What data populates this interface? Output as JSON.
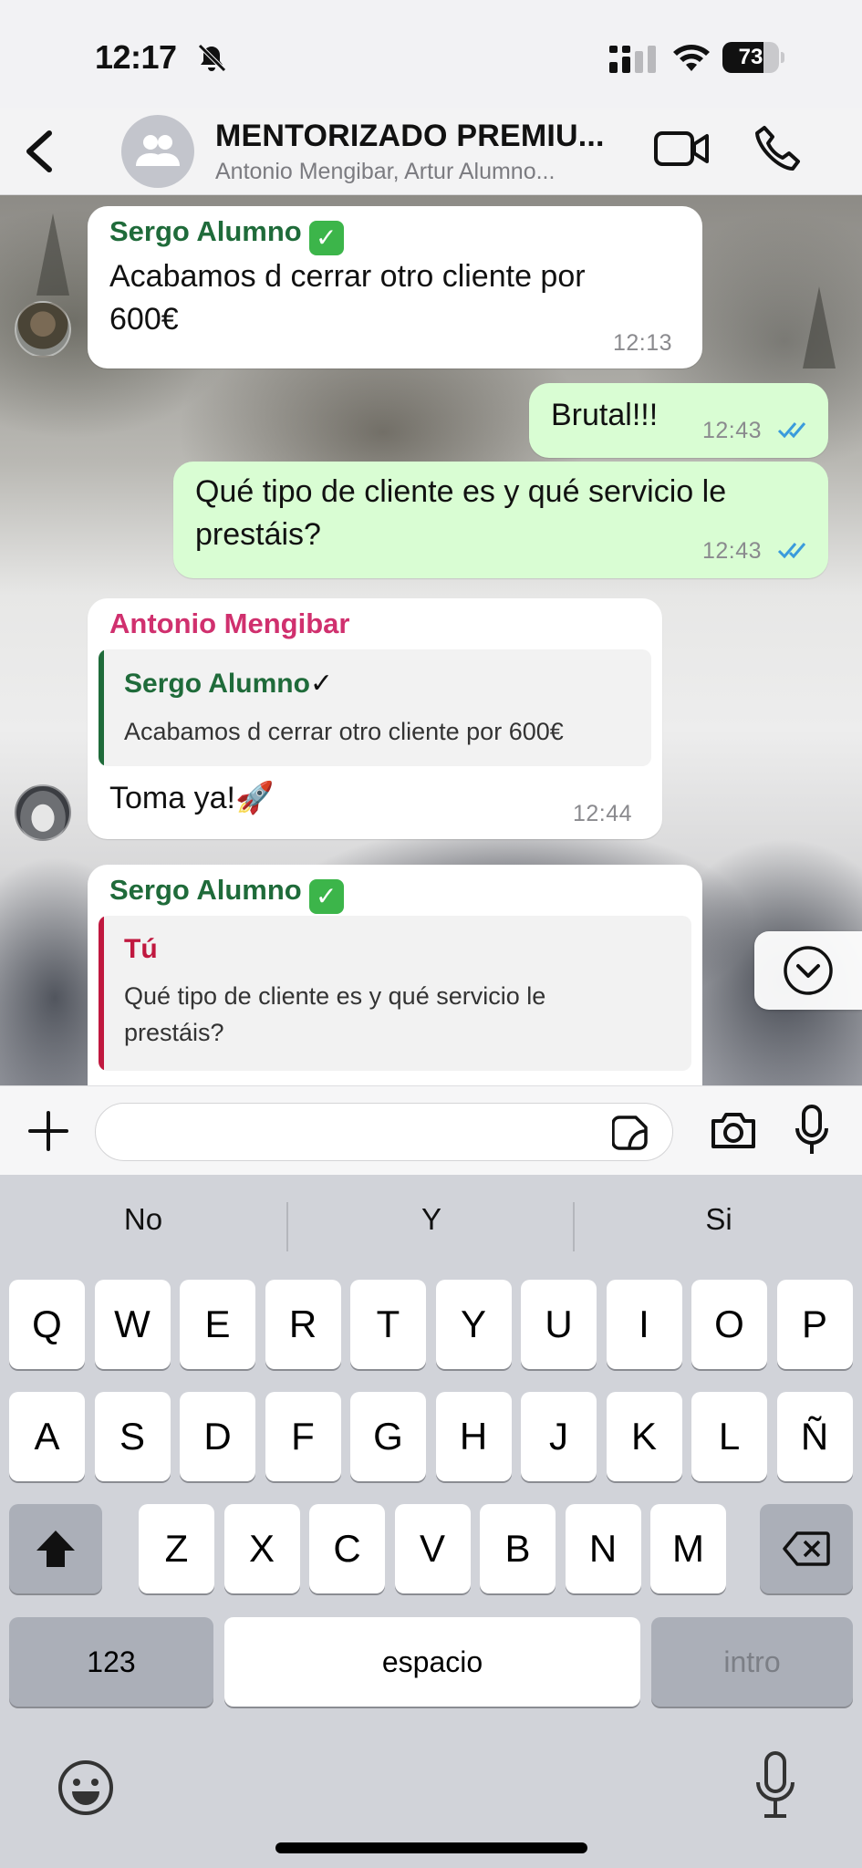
{
  "status_bar": {
    "time": "12:17",
    "battery_level": "73",
    "battery_fraction": 0.73,
    "icons": [
      "bell-slash-icon",
      "cellular-signal-icon",
      "wifi-icon",
      "battery-icon"
    ]
  },
  "header": {
    "title": "MENTORIZADO PREMIU...",
    "subtitle": "Antonio Mengibar, Artur Alumno...",
    "icons": [
      "chevron-left-icon",
      "group-avatar-icon",
      "video-camera-icon",
      "phone-icon"
    ]
  },
  "messages": [
    {
      "sender": "Sergo Alumno",
      "badge": "✅",
      "text_line1": "Acabamos d cerrar otro cliente por",
      "text_line2": "600€",
      "time": "12:13",
      "direction": "incoming"
    },
    {
      "text": "Brutal!!!",
      "time": "12:43",
      "direction": "outgoing",
      "status": "read"
    },
    {
      "text_line1": "Qué tipo de cliente es y qué servicio le",
      "text_line2": "prestáis?",
      "time": "12:43",
      "direction": "outgoing",
      "status": "read"
    },
    {
      "sender": "Antonio Mengibar",
      "quote": {
        "sender": "Sergo Alumno",
        "badge": "✅",
        "text": "Acabamos d cerrar otro cliente por 600€"
      },
      "text": "Toma ya!🚀",
      "time": "12:44",
      "direction": "incoming"
    },
    {
      "sender": "Sergo Alumno",
      "badge": "✅",
      "quote": {
        "sender": "Tú",
        "text_line1": "Qué tipo de cliente es y qué servicio le",
        "text_line2": "prestáis?"
      },
      "direction": "incoming"
    }
  ],
  "colors": {
    "sergo_name": "#1f6b3a",
    "antonio_name": "#d0306e",
    "tu_name": "#c0183f",
    "outgoing_bubble": "#d9fdd3",
    "read_ticks": "#3a9bdc"
  },
  "input_bar": {
    "placeholder": "",
    "icons": [
      "plus-icon",
      "sticker-icon",
      "camera-icon",
      "microphone-icon"
    ]
  },
  "keyboard": {
    "suggestions": [
      "No",
      "Y",
      "Si"
    ],
    "row1": [
      "Q",
      "W",
      "E",
      "R",
      "T",
      "Y",
      "U",
      "I",
      "O",
      "P"
    ],
    "row2": [
      "A",
      "S",
      "D",
      "F",
      "G",
      "H",
      "J",
      "K",
      "L",
      "Ñ"
    ],
    "row3": [
      "Z",
      "X",
      "C",
      "V",
      "B",
      "N",
      "M"
    ],
    "numbers_key": "123",
    "space_key": "espacio",
    "return_key": "intro",
    "icons": [
      "shift-icon",
      "delete-icon",
      "emoji-icon",
      "dictation-mic-icon"
    ]
  }
}
